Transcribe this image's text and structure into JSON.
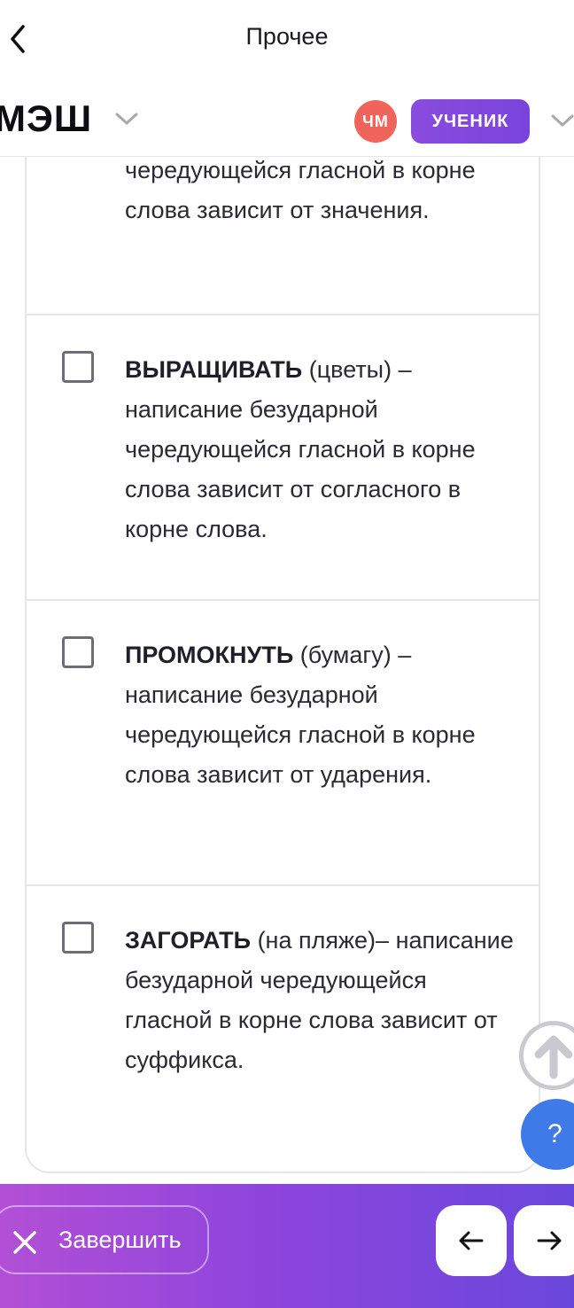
{
  "topbar": {
    "title": "Прочее"
  },
  "appbar": {
    "logo": "МЭШ",
    "avatar_initials": "ЧМ",
    "role": "УЧЕНИК"
  },
  "options": [
    {
      "lines_prefix": "",
      "tail": "чередующейся гласной в корне слова зависит от значения.",
      "checked": false
    },
    {
      "word": "ВЫРАЩИВАТЬ",
      "rest": " (цветы) – написание безударной чередующейся гласной в корне слова зависит от согласного в корне слова.",
      "checked": false
    },
    {
      "word": "ПРОМОКНУТЬ",
      "rest": " (бумагу) – написание безударной чередующейся гласной в корне слова зависит от ударения.",
      "checked": false
    },
    {
      "word": "ЗАГОРАТЬ",
      "rest": " (на пляже)– написание безударной чередующейся гласной в корне слова зависит от суффикса.",
      "checked": false
    }
  ],
  "help": {
    "label": "?"
  },
  "bottombar": {
    "finish_label": "Завершить"
  },
  "colors": {
    "accent": "#8a4bdf",
    "avatar": "#f0645c",
    "help": "#3e7be8"
  },
  "icons": [
    "back-chevron-icon",
    "chevron-down-icon",
    "arrow-up-icon",
    "close-icon",
    "arrow-left-icon",
    "arrow-right-icon"
  ]
}
